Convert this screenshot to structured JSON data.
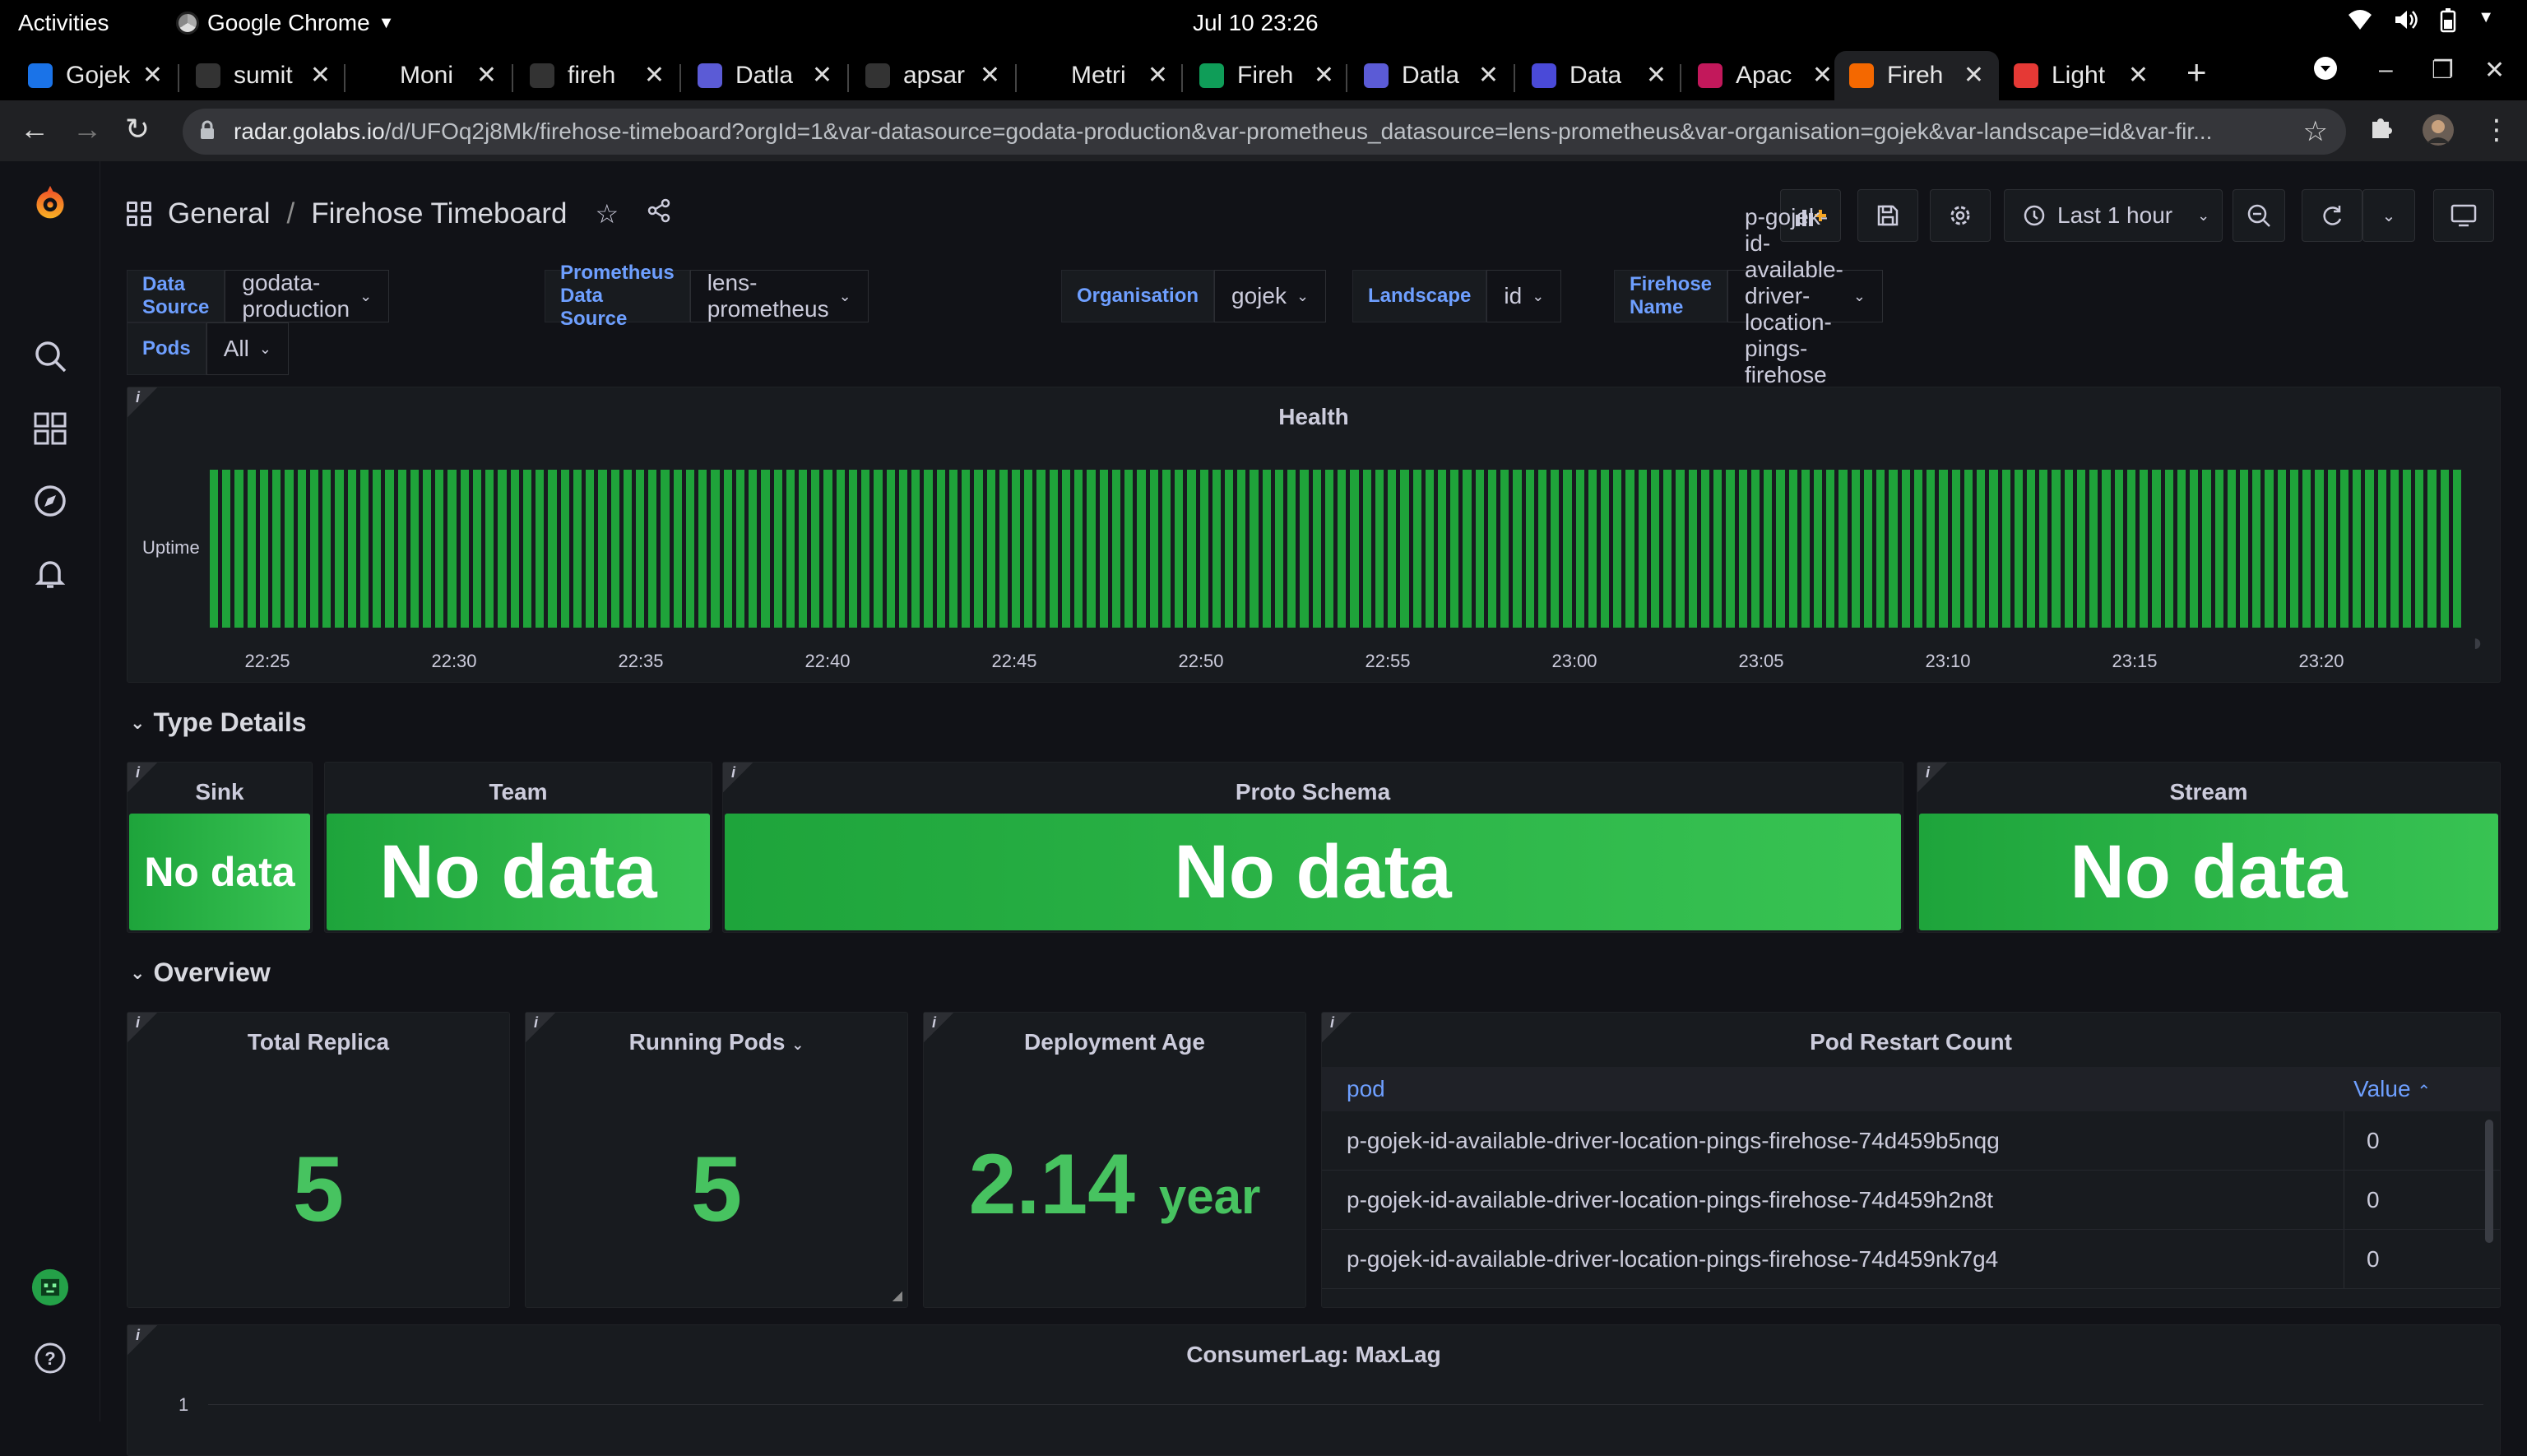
{
  "system_bar": {
    "activities": "Activities",
    "app_name": "Google Chrome",
    "clock": "Jul 10  23:26"
  },
  "browser": {
    "tabs": [
      {
        "label": "Gojek",
        "color": "#1a73e8"
      },
      {
        "label": "sumit",
        "color": "#333333"
      },
      {
        "label": "Moni",
        "color": "#000000"
      },
      {
        "label": "fireh",
        "color": "#333333"
      },
      {
        "label": "Datla",
        "color": "#5b5bd6"
      },
      {
        "label": "apsar",
        "color": "#333333"
      },
      {
        "label": "Metri",
        "color": "#000000"
      },
      {
        "label": "Fireh",
        "color": "#0f9d58"
      },
      {
        "label": "Datla",
        "color": "#5b5bd6"
      },
      {
        "label": "Data",
        "color": "#4a4ad8"
      },
      {
        "label": "Apac",
        "color": "#c2185b"
      },
      {
        "label": "Fireh",
        "color": "#f46800"
      },
      {
        "label": "Light",
        "color": "#e53935"
      }
    ],
    "active_tab_index": 11,
    "url_host": "radar.golabs.io",
    "url_path": "/d/UFOq2j8Mk/firehose-timeboard?orgId=1&var-datasource=godata-production&var-prometheus_datasource=lens-prometheus&var-organisation=gojek&var-landscape=id&var-fir..."
  },
  "dashboard": {
    "breadcrumb_folder": "General",
    "breadcrumb_sep": "/",
    "title": "Firehose Timeboard",
    "time_range": "Last 1 hour",
    "variables": [
      {
        "label": "Data Source",
        "value": "godata-production"
      },
      {
        "label": "Prometheus Data Source",
        "value": "lens-prometheus"
      },
      {
        "label": "Organisation",
        "value": "gojek"
      },
      {
        "label": "Landscape",
        "value": "id"
      },
      {
        "label": "Firehose Name",
        "value": "p-gojek-id-available-driver-location-pings-firehose"
      },
      {
        "label": "Pods",
        "value": "All"
      }
    ]
  },
  "health_panel": {
    "title": "Health",
    "row_label": "Uptime",
    "x_ticks": [
      "22:25",
      "22:30",
      "22:35",
      "22:40",
      "22:45",
      "22:50",
      "22:55",
      "23:00",
      "23:05",
      "23:10",
      "23:15",
      "23:20"
    ],
    "bar_count": 180,
    "bar_color": "#1fa33a"
  },
  "type_details": {
    "row_title": "Type Details",
    "panels": [
      {
        "title": "Sink",
        "value": "No data"
      },
      {
        "title": "Team",
        "value": "No data"
      },
      {
        "title": "Proto Schema",
        "value": "No data"
      },
      {
        "title": "Stream",
        "value": "No data"
      }
    ]
  },
  "overview": {
    "row_title": "Overview",
    "total_replica": {
      "title": "Total Replica",
      "value": "5"
    },
    "running_pods": {
      "title": "Running Pods",
      "value": "5"
    },
    "deployment_age": {
      "title": "Deployment Age",
      "value": "2.14",
      "unit": "year"
    },
    "pod_restart": {
      "title": "Pod Restart Count",
      "col_pod": "pod",
      "col_value": "Value",
      "rows": [
        {
          "pod": "p-gojek-id-available-driver-location-pings-firehose-74d459b5nqg",
          "value": "0"
        },
        {
          "pod": "p-gojek-id-available-driver-location-pings-firehose-74d459h2n8t",
          "value": "0"
        },
        {
          "pod": "p-gojek-id-available-driver-location-pings-firehose-74d459nk7g4",
          "value": "0"
        }
      ]
    }
  },
  "consumer_lag": {
    "title": "ConsumerLag: MaxLag",
    "y_tick": "1"
  },
  "accent_green": "#47c360",
  "accent_blue": "#6e9fff"
}
